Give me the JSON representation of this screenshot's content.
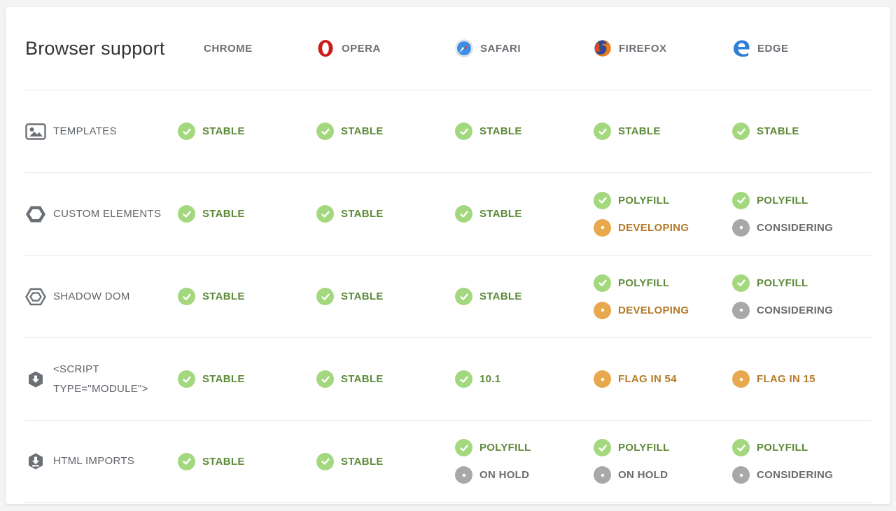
{
  "title": "Browser support",
  "browsers": [
    {
      "name": "CHROME",
      "icon": "none"
    },
    {
      "name": "OPERA",
      "icon": "opera-icon"
    },
    {
      "name": "SAFARI",
      "icon": "safari-icon"
    },
    {
      "name": "FIREFOX",
      "icon": "firefox-icon"
    },
    {
      "name": "EDGE",
      "icon": "edge-icon"
    }
  ],
  "colors": {
    "stable": "#a4d87f",
    "developing": "#e8a84d",
    "considering": "#a8a8a8"
  },
  "features": [
    {
      "name": "TEMPLATES",
      "icon": "image-icon",
      "statuses": [
        [
          {
            "label": "STABLE",
            "kind": "stable"
          }
        ],
        [
          {
            "label": "STABLE",
            "kind": "stable"
          }
        ],
        [
          {
            "label": "STABLE",
            "kind": "stable"
          }
        ],
        [
          {
            "label": "STABLE",
            "kind": "stable"
          }
        ],
        [
          {
            "label": "STABLE",
            "kind": "stable"
          }
        ]
      ]
    },
    {
      "name": "CUSTOM ELEMENTS",
      "icon": "hexagon-icon",
      "statuses": [
        [
          {
            "label": "STABLE",
            "kind": "stable"
          }
        ],
        [
          {
            "label": "STABLE",
            "kind": "stable"
          }
        ],
        [
          {
            "label": "STABLE",
            "kind": "stable"
          }
        ],
        [
          {
            "label": "POLYFILL",
            "kind": "stable"
          },
          {
            "label": "DEVELOPING",
            "kind": "developing"
          }
        ],
        [
          {
            "label": "POLYFILL",
            "kind": "stable"
          },
          {
            "label": "CONSIDERING",
            "kind": "considering"
          }
        ]
      ]
    },
    {
      "name": "SHADOW DOM",
      "icon": "hexagon-outline-icon",
      "statuses": [
        [
          {
            "label": "STABLE",
            "kind": "stable"
          }
        ],
        [
          {
            "label": "STABLE",
            "kind": "stable"
          }
        ],
        [
          {
            "label": "STABLE",
            "kind": "stable"
          }
        ],
        [
          {
            "label": "POLYFILL",
            "kind": "stable"
          },
          {
            "label": "DEVELOPING",
            "kind": "developing"
          }
        ],
        [
          {
            "label": "POLYFILL",
            "kind": "stable"
          },
          {
            "label": "CONSIDERING",
            "kind": "considering"
          }
        ]
      ]
    },
    {
      "name": "<SCRIPT TYPE=\"MODULE\">",
      "name_lines": [
        "<SCRIPT",
        "TYPE=\"MODULE\">"
      ],
      "icon": "module-download-icon",
      "statuses": [
        [
          {
            "label": "STABLE",
            "kind": "stable"
          }
        ],
        [
          {
            "label": "STABLE",
            "kind": "stable"
          }
        ],
        [
          {
            "label": "10.1",
            "kind": "stable"
          }
        ],
        [
          {
            "label": "FLAG IN 54",
            "kind": "developing"
          }
        ],
        [
          {
            "label": "FLAG IN 15",
            "kind": "developing"
          }
        ]
      ]
    },
    {
      "name": "HTML IMPORTS",
      "icon": "import-download-icon",
      "statuses": [
        [
          {
            "label": "STABLE",
            "kind": "stable"
          }
        ],
        [
          {
            "label": "STABLE",
            "kind": "stable"
          }
        ],
        [
          {
            "label": "POLYFILL",
            "kind": "stable"
          },
          {
            "label": "ON HOLD",
            "kind": "considering"
          }
        ],
        [
          {
            "label": "POLYFILL",
            "kind": "stable"
          },
          {
            "label": "ON HOLD",
            "kind": "considering"
          }
        ],
        [
          {
            "label": "POLYFILL",
            "kind": "stable"
          },
          {
            "label": "CONSIDERING",
            "kind": "considering"
          }
        ]
      ]
    }
  ]
}
